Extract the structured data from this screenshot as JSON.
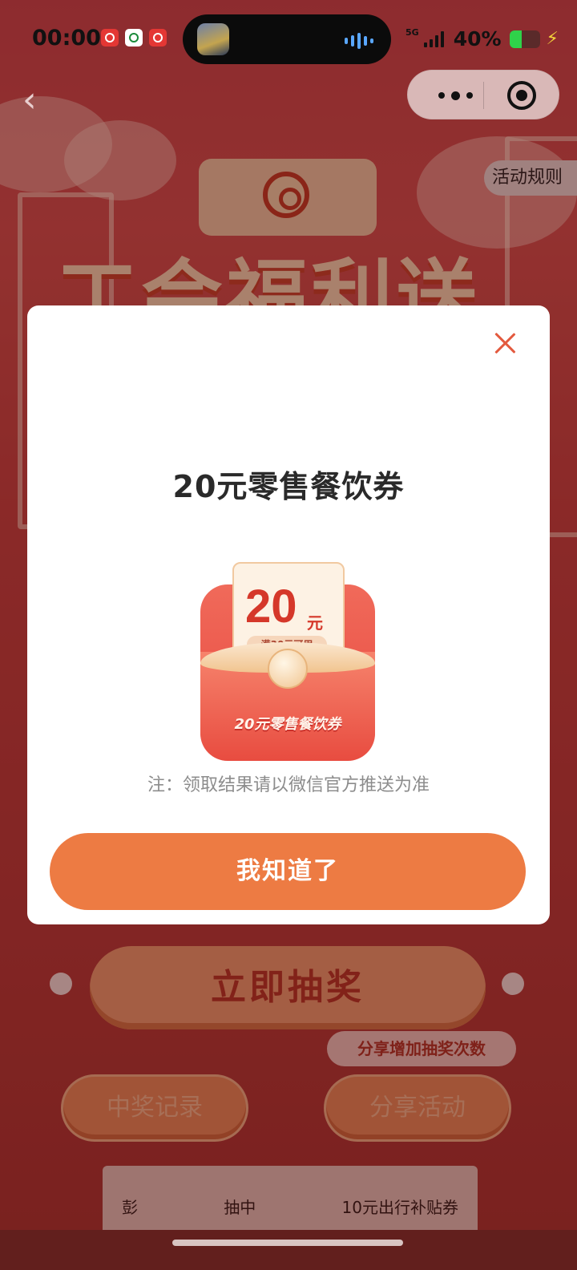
{
  "status_bar": {
    "time": "00:00",
    "network": "5G",
    "battery_percent": "40%",
    "battery_level": 0.4
  },
  "background_page": {
    "banner_title": "工会福利送",
    "rules_label": "活动规则",
    "lottery_button": "立即抽奖",
    "share_tip": "分享增加抽奖次数",
    "records_button": "中奖记录",
    "share_button": "分享活动",
    "record_row": [
      "彭",
      "抽中",
      "10元出行补贴券"
    ]
  },
  "modal": {
    "prize_title": "20元零售餐饮券",
    "coupon": {
      "amount": "20",
      "unit": "元",
      "condition": "满30元可用",
      "envelope_label": "20元零售餐饮券"
    },
    "note": "注：领取结果请以微信官方推送为准",
    "confirm_label": "我知道了"
  },
  "colors": {
    "accent": "#ed7b43",
    "close_icon": "#e35a3f",
    "coupon_red": "#d5382a"
  }
}
